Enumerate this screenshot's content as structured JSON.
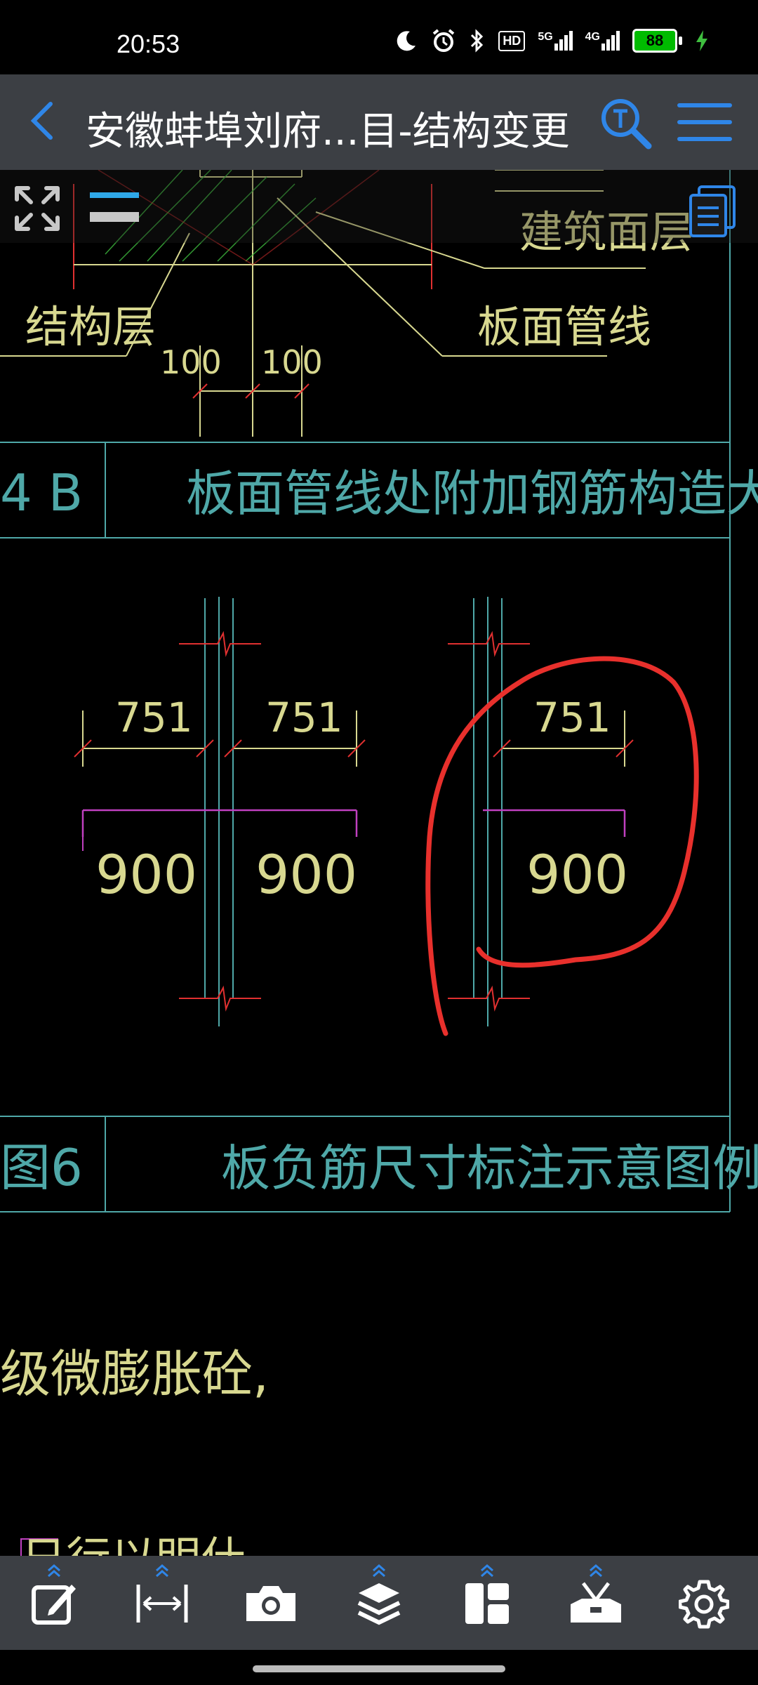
{
  "status": {
    "time": "20:53",
    "hd_badge": "HD",
    "net1": "5G",
    "net2": "4G",
    "battery": "88",
    "icons": [
      "moon-icon",
      "alarm-icon",
      "bluetooth-icon",
      "hd-voice-icon",
      "signal-5g-icon",
      "signal-4g-icon",
      "battery-icon",
      "charging-icon"
    ]
  },
  "appbar": {
    "title": "安徽蚌埠刘府...目-结构变更",
    "back_icon": "chevron-left-icon",
    "search_icon": "text-search-icon",
    "menu_icon": "hamburger-menu-icon"
  },
  "drawing": {
    "label_arch_surface": "建筑面层",
    "label_struct_layer": "结构层",
    "label_pipe": "板面管线",
    "dim_100_left": "100",
    "dim_100_right": "100",
    "detail_no_1": "4 B",
    "detail_title_1": "板面管线处附加钢筋构造大样",
    "dim_751_a": "751",
    "dim_751_b": "751",
    "dim_751_c": "751",
    "dim_900_a": "900",
    "dim_900_b": "900",
    "dim_900_c": "900",
    "detail_no_2": "图6",
    "detail_title_2": "板负筋尺寸标注示意图例",
    "note_text": "级微膨胀砼,",
    "note_text_2": "日行以明什",
    "colors": {
      "cyan": "#4fa8a8",
      "yellow": "#d8d890",
      "red": "#e03030",
      "magenta": "#c040c0",
      "green": "#40c040",
      "markup": "#e8302c"
    }
  },
  "cad_toolbar": {
    "expand_icon": "expand-icon",
    "minimize_icon": "minimize-icon",
    "pages_icon": "pages-icon"
  },
  "bottom_tools": [
    {
      "name": "edit-tool",
      "icon": "edit-icon"
    },
    {
      "name": "measure-tool",
      "icon": "measure-icon"
    },
    {
      "name": "camera-tool",
      "icon": "camera-icon"
    },
    {
      "name": "layers-tool",
      "icon": "layers-icon"
    },
    {
      "name": "layout-tool",
      "icon": "layout-icon"
    },
    {
      "name": "toolbox-tool",
      "icon": "toolbox-icon"
    },
    {
      "name": "settings-tool",
      "icon": "gear-icon"
    }
  ]
}
